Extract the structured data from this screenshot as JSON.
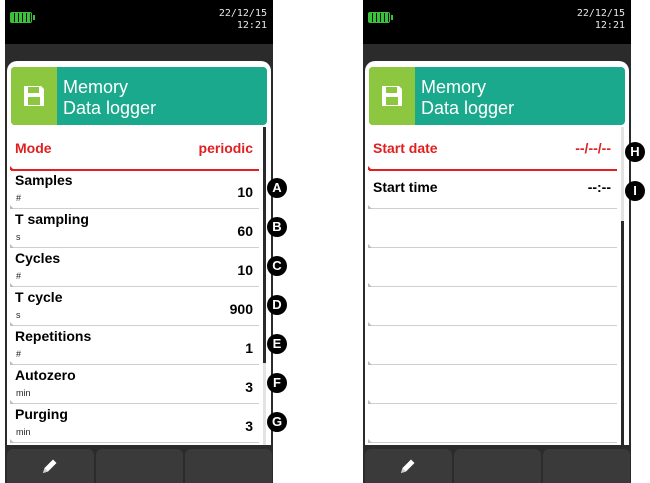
{
  "colors": {
    "header_bg": "#1aa98c",
    "header_icon_bg": "#8dc63f",
    "active_red": "#e02020",
    "battery_green": "#3ac23a"
  },
  "left": {
    "date": "22/12/15",
    "time": "12:21",
    "header": {
      "line1": "Memory",
      "line2": "Data logger",
      "icon": "save-icon"
    },
    "rows": [
      {
        "label": "Mode",
        "unit": "",
        "value": "periodic",
        "marker": ""
      },
      {
        "label": "Samples",
        "unit": "#",
        "value": "10",
        "marker": "A"
      },
      {
        "label": "T sampling",
        "unit": "s",
        "value": "60",
        "marker": "B"
      },
      {
        "label": "Cycles",
        "unit": "#",
        "value": "10",
        "marker": "C"
      },
      {
        "label": "T cycle",
        "unit": "s",
        "value": "900",
        "marker": "D"
      },
      {
        "label": "Repetitions",
        "unit": "#",
        "value": "1",
        "marker": "E"
      },
      {
        "label": "Autozero",
        "unit": "min",
        "value": "3",
        "marker": "F"
      },
      {
        "label": "Purging",
        "unit": "min",
        "value": "3",
        "marker": "G"
      }
    ],
    "softkeys": [
      {
        "icon": "pencil-icon"
      },
      {
        "icon": ""
      },
      {
        "icon": ""
      }
    ]
  },
  "right": {
    "date": "22/12/15",
    "time": "12:21",
    "header": {
      "line1": "Memory",
      "line2": "Data logger",
      "icon": "save-icon"
    },
    "rows": [
      {
        "label": "Start date",
        "unit": "",
        "value": "--/--/--",
        "marker": "H"
      },
      {
        "label": "Start time",
        "unit": "",
        "value": "--:--",
        "marker": "I"
      },
      {
        "label": "",
        "unit": "",
        "value": "",
        "marker": ""
      },
      {
        "label": "",
        "unit": "",
        "value": "",
        "marker": ""
      },
      {
        "label": "",
        "unit": "",
        "value": "",
        "marker": ""
      },
      {
        "label": "",
        "unit": "",
        "value": "",
        "marker": ""
      },
      {
        "label": "",
        "unit": "",
        "value": "",
        "marker": ""
      },
      {
        "label": "",
        "unit": "",
        "value": "",
        "marker": ""
      }
    ],
    "softkeys": [
      {
        "icon": "pencil-icon"
      },
      {
        "icon": ""
      },
      {
        "icon": ""
      }
    ]
  }
}
